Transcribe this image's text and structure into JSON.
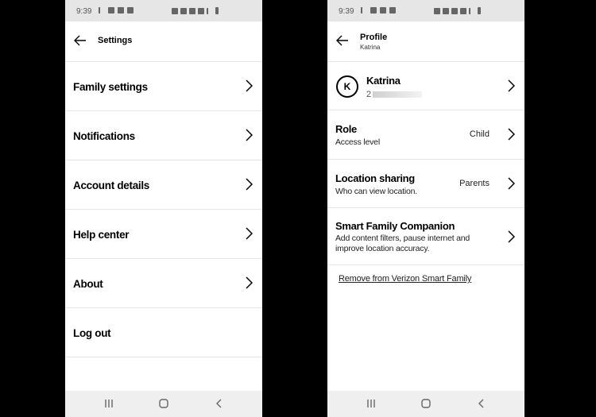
{
  "statusbar": {
    "time": "9:39"
  },
  "left_screen": {
    "header": {
      "title": "Settings"
    },
    "items": [
      {
        "label": "Family settings",
        "has_chevron": true
      },
      {
        "label": "Notifications",
        "has_chevron": true
      },
      {
        "label": "Account details",
        "has_chevron": true
      },
      {
        "label": "Help center",
        "has_chevron": true
      },
      {
        "label": "About",
        "has_chevron": true
      },
      {
        "label": "Log out",
        "has_chevron": false
      }
    ]
  },
  "right_screen": {
    "header": {
      "title": "Profile",
      "subtitle": "Katrina"
    },
    "profile": {
      "initial": "K",
      "name": "Katrina",
      "phone_partial": "2"
    },
    "items": [
      {
        "title": "Role",
        "subtitle": "Access level",
        "value": "Child"
      },
      {
        "title": "Location sharing",
        "subtitle": "Who can view location.",
        "value": "Parents"
      },
      {
        "title": "Smart Family Companion",
        "subtitle": "Add content filters, pause internet and improve location accuracy.",
        "value": ""
      }
    ],
    "remove_link": "Remove from Verizon Smart Family"
  },
  "navbar": {
    "recents": "recents",
    "home": "home",
    "back": "back"
  }
}
